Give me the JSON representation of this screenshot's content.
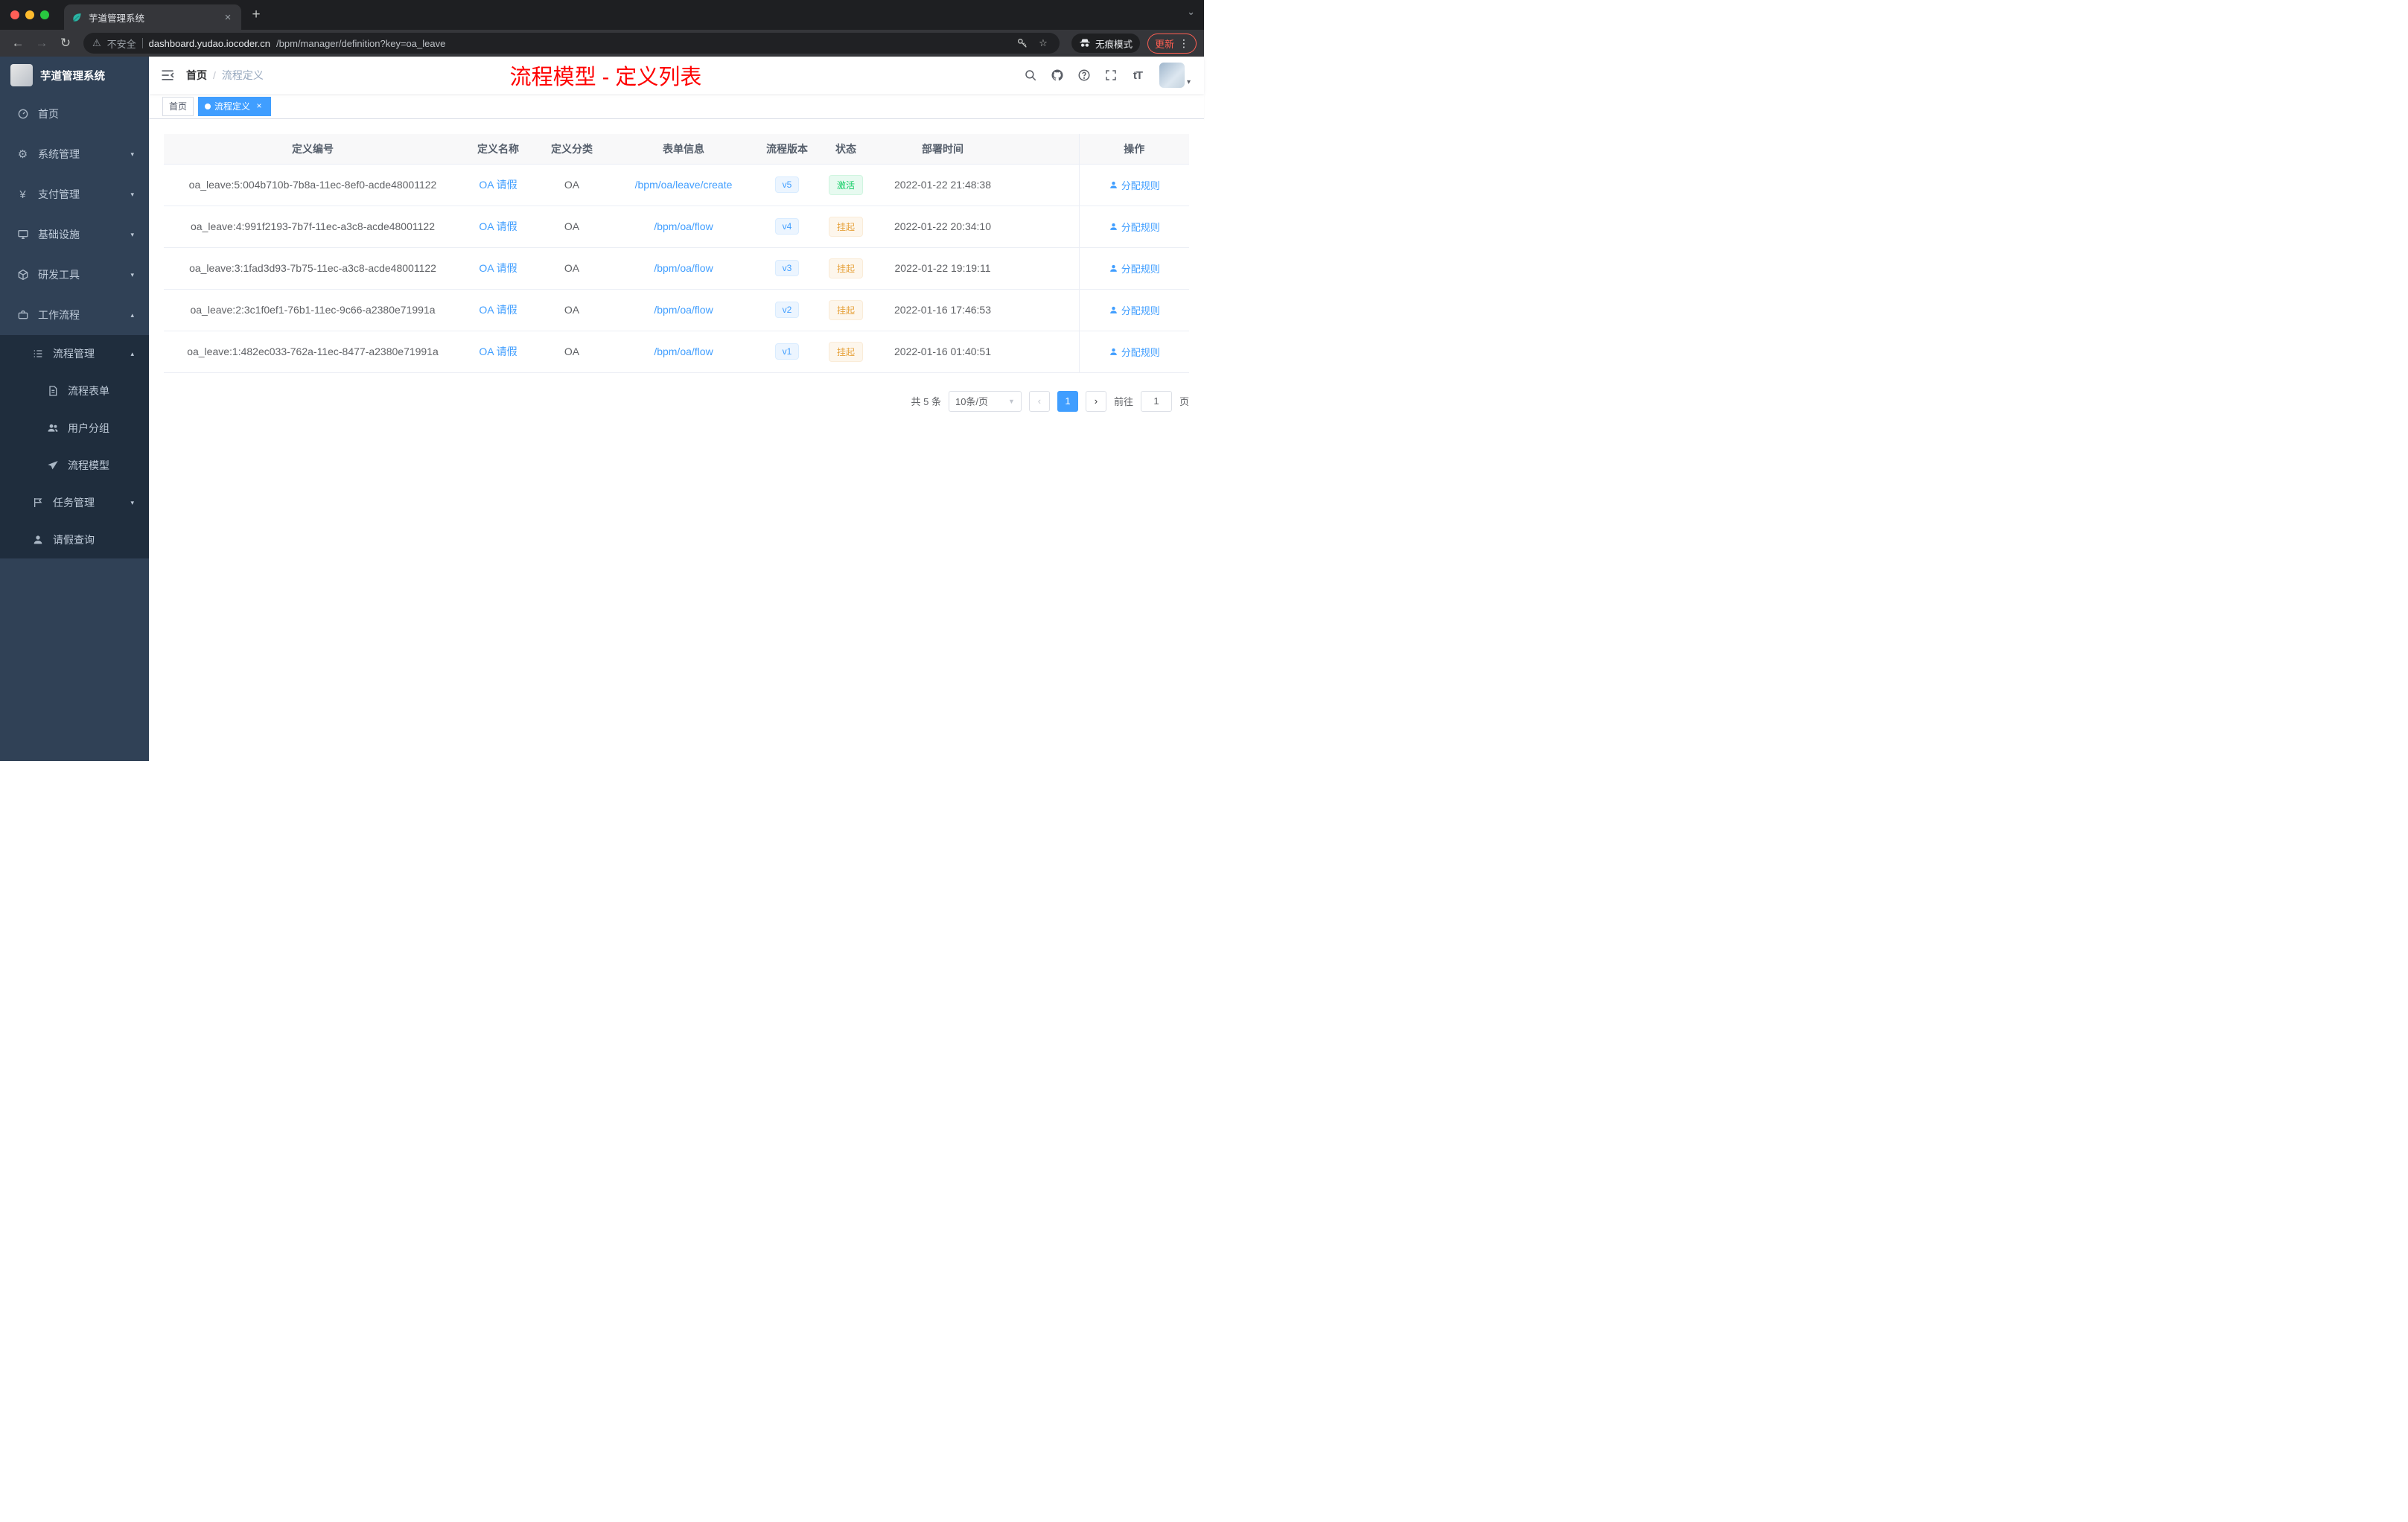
{
  "browser": {
    "tab": {
      "title": "芋道管理系统"
    },
    "new_tab_symbol": "+",
    "address": {
      "security_label": "不安全",
      "host": "dashboard.yudao.iocoder.cn",
      "path": "/bpm/manager/definition?key=oa_leave"
    },
    "incognito_label": "无痕模式",
    "update_label": "更新"
  },
  "sidebar": {
    "logo_title": "芋道管理系统",
    "items": [
      {
        "label": "首页"
      },
      {
        "label": "系统管理"
      },
      {
        "label": "支付管理"
      },
      {
        "label": "基础设施"
      },
      {
        "label": "研发工具"
      },
      {
        "label": "工作流程"
      }
    ],
    "workflow_children": {
      "process_mgmt": {
        "label": "流程管理"
      },
      "process_children": [
        {
          "label": "流程表单"
        },
        {
          "label": "用户分组"
        },
        {
          "label": "流程模型"
        }
      ],
      "task_mgmt": {
        "label": "任务管理"
      },
      "leave_query": {
        "label": "请假查询"
      }
    }
  },
  "navbar": {
    "breadcrumb_home": "首页",
    "breadcrumb_separator": "/",
    "breadcrumb_current": "流程定义",
    "annotation": "流程模型 - 定义列表"
  },
  "tags": {
    "home": "首页",
    "active": "流程定义"
  },
  "table": {
    "columns": [
      "定义编号",
      "定义名称",
      "定义分类",
      "表单信息",
      "流程版本",
      "状态",
      "部署时间",
      "操作"
    ],
    "rows": [
      {
        "id": "oa_leave:5:004b710b-7b8a-11ec-8ef0-acde48001122",
        "name": "OA 请假",
        "category": "OA",
        "form": "/bpm/oa/leave/create",
        "version": "v5",
        "status": "激活",
        "time": "2022-01-22 21:48:38",
        "action": "分配规则"
      },
      {
        "id": "oa_leave:4:991f2193-7b7f-11ec-a3c8-acde48001122",
        "name": "OA 请假",
        "category": "OA",
        "form": "/bpm/oa/flow",
        "version": "v4",
        "status": "挂起",
        "time": "2022-01-22 20:34:10",
        "action": "分配规则"
      },
      {
        "id": "oa_leave:3:1fad3d93-7b75-11ec-a3c8-acde48001122",
        "name": "OA 请假",
        "category": "OA",
        "form": "/bpm/oa/flow",
        "version": "v3",
        "status": "挂起",
        "time": "2022-01-22 19:19:11",
        "action": "分配规则"
      },
      {
        "id": "oa_leave:2:3c1f0ef1-76b1-11ec-9c66-a2380e71991a",
        "name": "OA 请假",
        "category": "OA",
        "form": "/bpm/oa/flow",
        "version": "v2",
        "status": "挂起",
        "time": "2022-01-16 17:46:53",
        "action": "分配规则"
      },
      {
        "id": "oa_leave:1:482ec033-762a-11ec-8477-a2380e71991a",
        "name": "OA 请假",
        "category": "OA",
        "form": "/bpm/oa/flow",
        "version": "v1",
        "status": "挂起",
        "time": "2022-01-16 01:40:51",
        "action": "分配规则"
      }
    ]
  },
  "pagination": {
    "total": "共 5 条",
    "page_size": "10条/页",
    "current_page": "1",
    "goto_label": "前往",
    "goto_value": "1",
    "goto_unit": "页"
  },
  "colors": {
    "accent": "#409eff",
    "success": "#13ce66",
    "warning": "#e6a23c",
    "annotation_red": "#fe0000",
    "sidebar_bg": "#304156",
    "submenu_bg": "#1f2d3d"
  }
}
